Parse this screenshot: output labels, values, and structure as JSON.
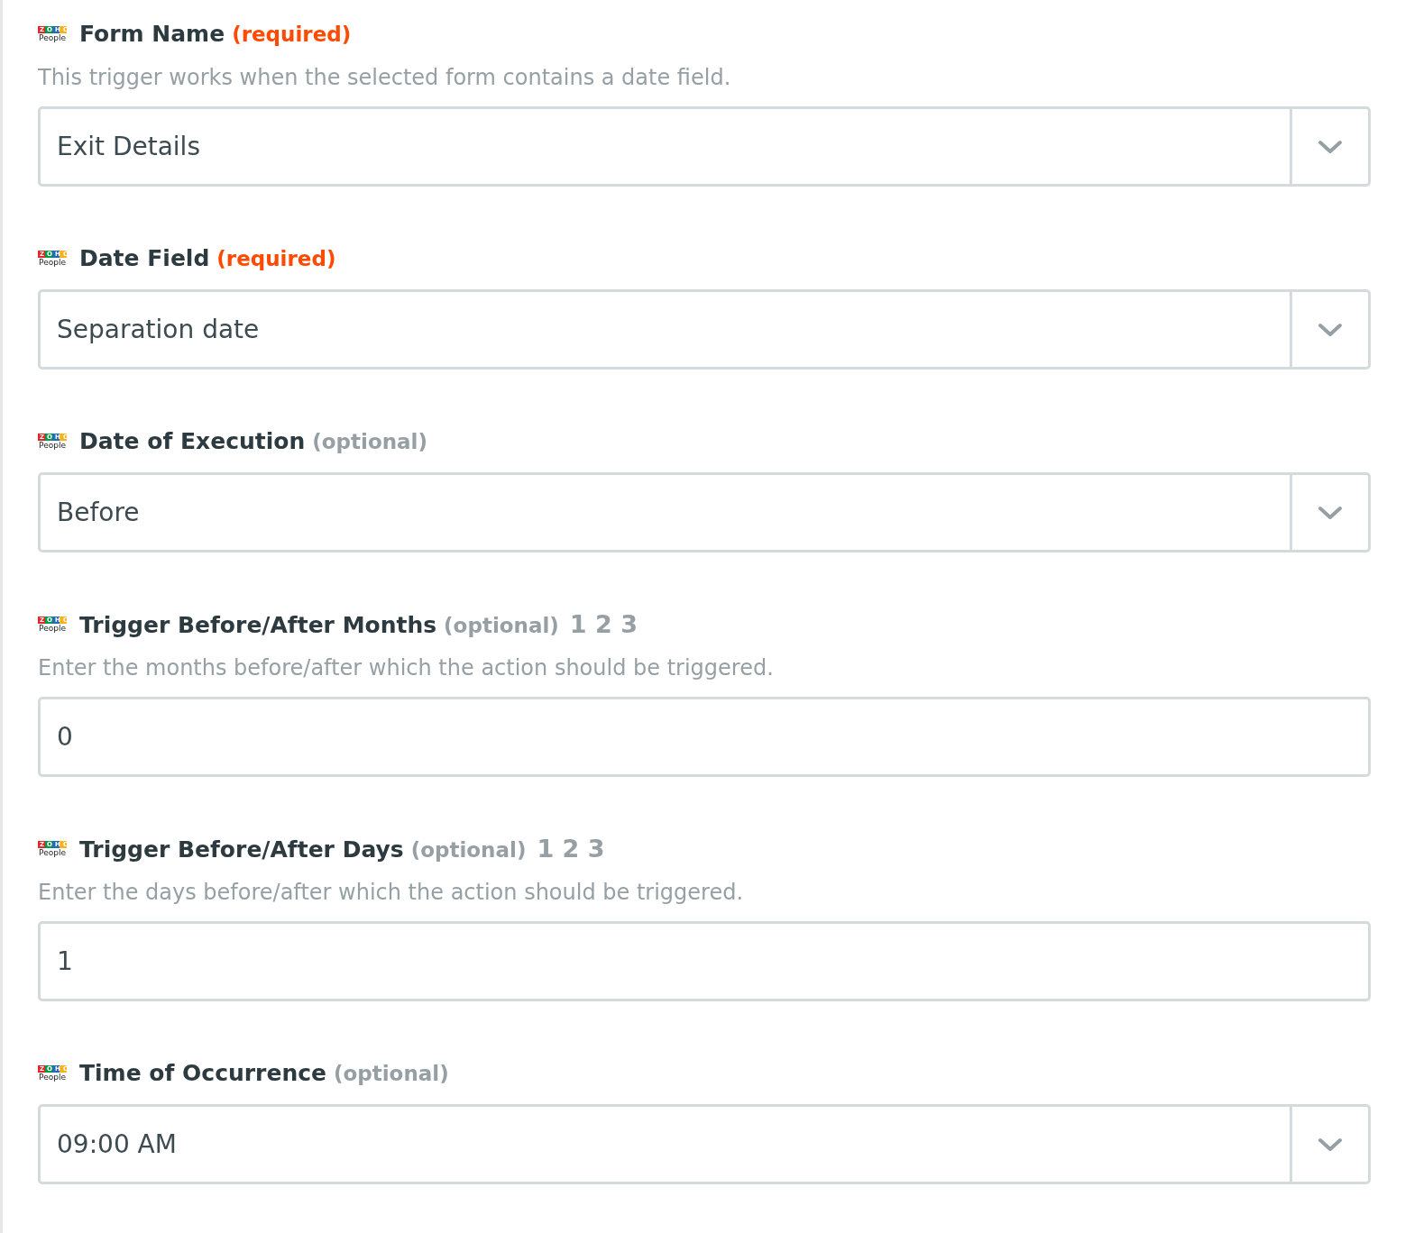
{
  "fields": [
    {
      "kind": "select",
      "logo": {
        "mark": "ZOHO",
        "caption": "People"
      },
      "label": "Form Name",
      "tag": {
        "kind": "required",
        "text": "(required)"
      },
      "description": "This trigger works when the selected form contains a date field.",
      "value": "Exit Details"
    },
    {
      "kind": "select",
      "logo": {
        "mark": "ZOHO",
        "caption": "People"
      },
      "label": "Date Field",
      "tag": {
        "kind": "required",
        "text": "(required)"
      },
      "value": "Separation date"
    },
    {
      "kind": "select",
      "logo": {
        "mark": "ZOHO",
        "caption": "People"
      },
      "label": "Date of Execution",
      "tag": {
        "kind": "optional",
        "text": "(optional)"
      },
      "value": "Before"
    },
    {
      "kind": "text",
      "logo": {
        "mark": "ZOHO",
        "caption": "People"
      },
      "label": "Trigger Before/After Months",
      "tag": {
        "kind": "optional",
        "text": "(optional)"
      },
      "type_hint": "1 2 3",
      "description": "Enter the months before/after which the action should be triggered.",
      "value": "0"
    },
    {
      "kind": "text",
      "logo": {
        "mark": "ZOHO",
        "caption": "People"
      },
      "label": "Trigger Before/After Days",
      "tag": {
        "kind": "optional",
        "text": "(optional)"
      },
      "type_hint": "1 2 3",
      "description": "Enter the days before/after which the action should be triggered.",
      "value": "1"
    },
    {
      "kind": "select",
      "logo": {
        "mark": "ZOHO",
        "caption": "People"
      },
      "label": "Time of Occurrence",
      "tag": {
        "kind": "optional",
        "text": "(optional)"
      },
      "value": "09:00 AM"
    }
  ]
}
